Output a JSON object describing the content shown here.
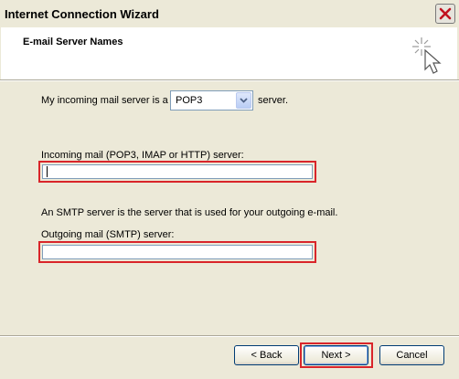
{
  "window": {
    "title": "Internet Connection Wizard"
  },
  "header": {
    "title": "E-mail Server Names"
  },
  "incoming_type": {
    "prefix": "My incoming mail server is a",
    "selected": "POP3",
    "suffix": "server."
  },
  "incoming_server": {
    "label": "Incoming mail (POP3, IMAP or HTTP) server:",
    "value": ""
  },
  "smtp_note": "An SMTP server is the server that is used for your outgoing e-mail.",
  "outgoing_server": {
    "label": "Outgoing mail (SMTP) server:",
    "value": ""
  },
  "buttons": {
    "back": "< Back",
    "next": "Next >",
    "cancel": "Cancel"
  },
  "icons": {
    "close": "close-icon",
    "wizard": "wizard-wand-icon",
    "dropdown": "chevron-down-icon"
  },
  "colors": {
    "close_accent": "#c1121f",
    "highlight_outline": "#d9252a"
  }
}
